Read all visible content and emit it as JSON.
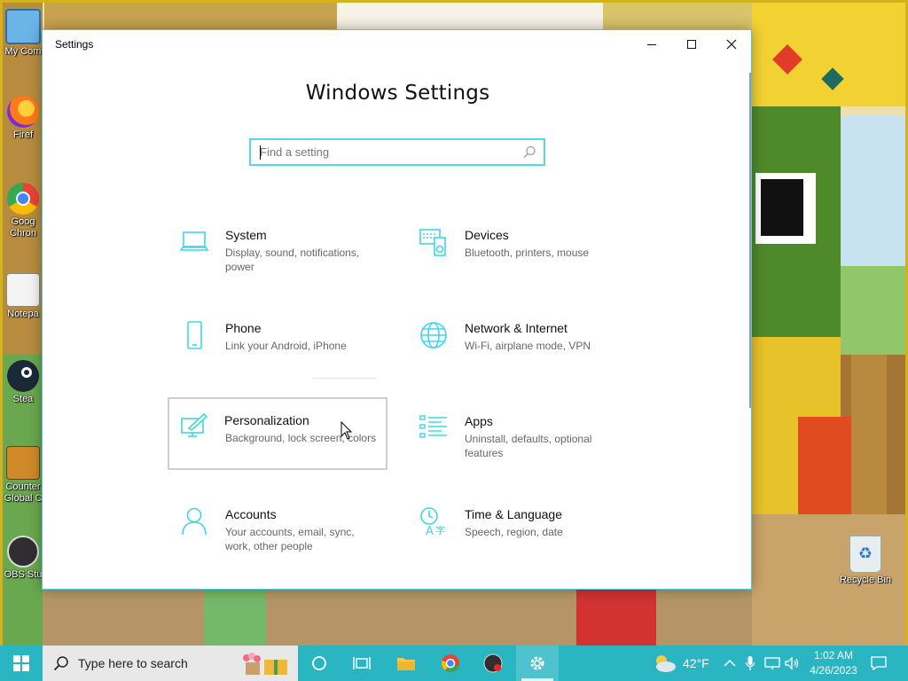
{
  "desktop": {
    "icons": [
      {
        "label": "My Com"
      },
      {
        "label": "Firef"
      },
      {
        "label": "Goog\nChron"
      },
      {
        "label": "Notepa"
      },
      {
        "label": "Stea"
      },
      {
        "label": "Counter\nGlobal C"
      },
      {
        "label": "OBS Stu"
      }
    ],
    "recycle_bin": "Recycle Bin"
  },
  "window": {
    "title": "Settings",
    "minimize": "—",
    "maximize": "☐",
    "close": "✕",
    "heading": "Windows Settings",
    "search_placeholder": "Find a setting"
  },
  "tiles": [
    {
      "title": "System",
      "desc": "Display, sound, notifications, power",
      "icon": "laptop-icon"
    },
    {
      "title": "Devices",
      "desc": "Bluetooth, printers, mouse",
      "icon": "devices-icon"
    },
    {
      "title": "Phone",
      "desc": "Link your Android, iPhone",
      "icon": "phone-icon"
    },
    {
      "title": "Network & Internet",
      "desc": "Wi-Fi, airplane mode, VPN",
      "icon": "globe-icon"
    },
    {
      "title": "Personalization",
      "desc": "Background, lock screen, colors",
      "icon": "paint-icon"
    },
    {
      "title": "Apps",
      "desc": "Uninstall, defaults, optional features",
      "icon": "apps-list-icon"
    },
    {
      "title": "Accounts",
      "desc": "Your accounts, email, sync, work, other people",
      "icon": "person-icon"
    },
    {
      "title": "Time & Language",
      "desc": "Speech, region, date",
      "icon": "time-language-icon"
    }
  ],
  "taskbar": {
    "search_text": "Type here to search",
    "weather_temp": "42°F",
    "time": "1:02 AM",
    "date": "4/26/2023"
  },
  "colors": {
    "accent": "#29b6c2",
    "icon_cyan": "#3fd7e3"
  }
}
